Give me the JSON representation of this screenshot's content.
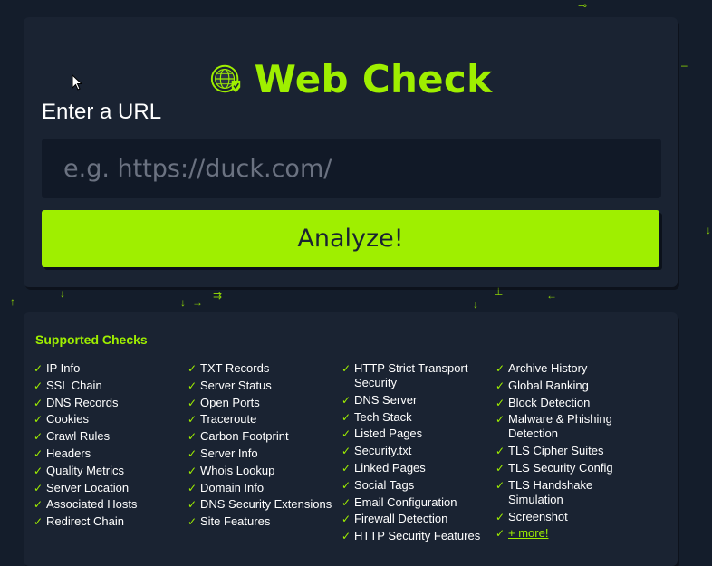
{
  "brand": {
    "title": "Web Check",
    "accent": "#9fef00",
    "background": "#141d2b",
    "card": "#1a2332",
    "icon": "globe-shield-icon"
  },
  "form": {
    "label": "Enter a URL",
    "placeholder": "e.g. https://duck.com/",
    "value": "",
    "submit_label": "Analyze!"
  },
  "checks": {
    "title": "Supported Checks",
    "tick_icon": "check-icon",
    "tick": "✓",
    "columns": [
      [
        "IP Info",
        "SSL Chain",
        "DNS Records",
        "Cookies",
        "Crawl Rules",
        "Headers",
        "Quality Metrics",
        "Server Location",
        "Associated Hosts",
        "Redirect Chain"
      ],
      [
        "TXT Records",
        "Server Status",
        "Open Ports",
        "Traceroute",
        "Carbon Footprint",
        "Server Info",
        "Whois Lookup",
        "Domain Info",
        "DNS Security Extensions",
        "Site Features"
      ],
      [
        "HTTP Strict Transport Security",
        "DNS Server",
        "Tech Stack",
        "Listed Pages",
        "Security.txt",
        "Linked Pages",
        "Social Tags",
        "Email Configuration",
        "Firewall Detection",
        "HTTP Security Features"
      ],
      [
        "Archive History",
        "Global Ranking",
        "Block Detection",
        "Malware & Phishing Detection",
        "TLS Cipher Suites",
        "TLS Security Config",
        "TLS Handshake Simulation",
        "Screenshot"
      ]
    ],
    "more_label": "+ more!"
  }
}
